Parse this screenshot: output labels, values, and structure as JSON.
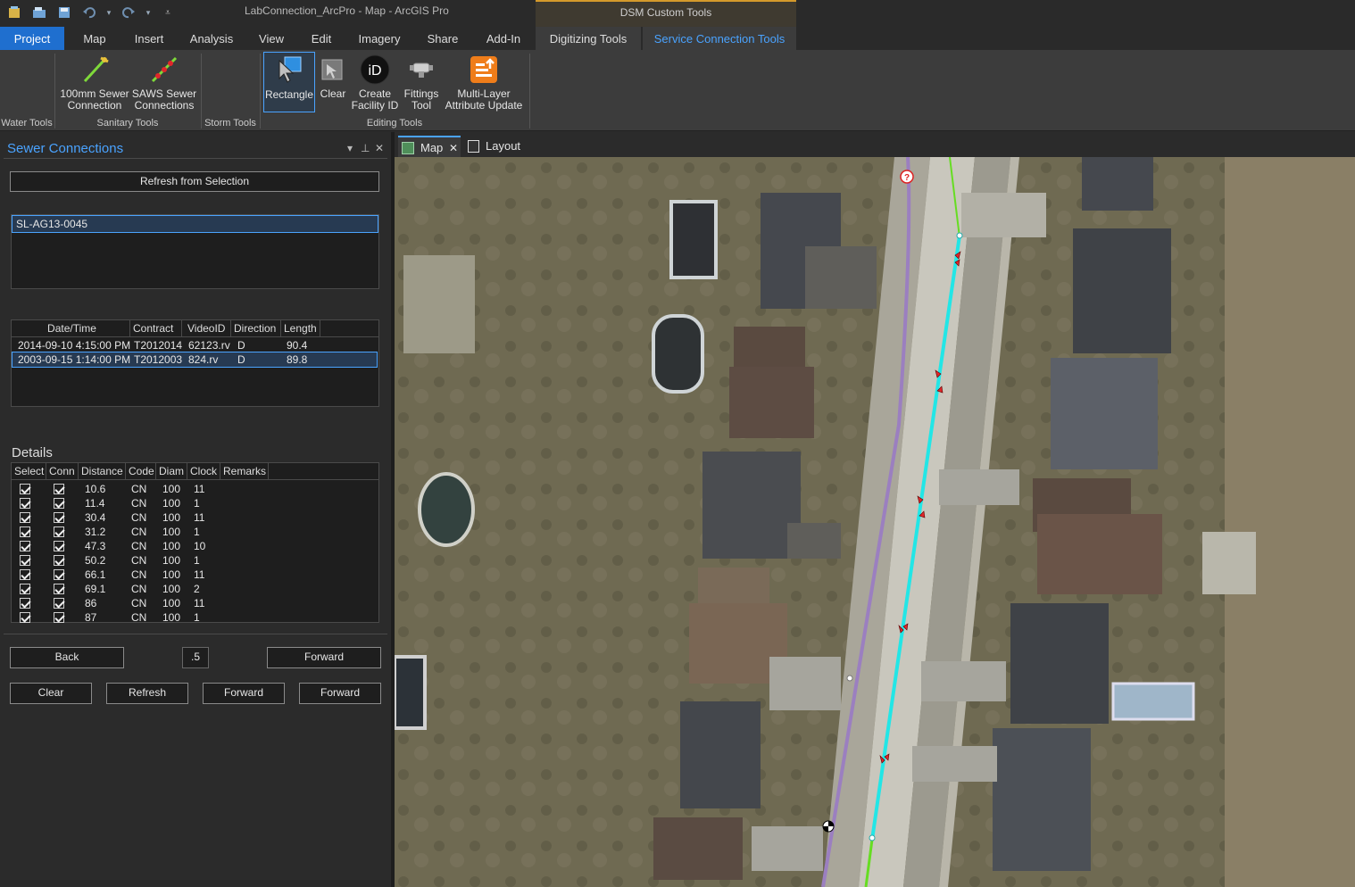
{
  "app": {
    "title": "LabConnection_ArcPro - Map - ArcGIS Pro",
    "context_header": "DSM Custom Tools"
  },
  "tabs": [
    {
      "label": "Project"
    },
    {
      "label": "Map"
    },
    {
      "label": "Insert"
    },
    {
      "label": "Analysis"
    },
    {
      "label": "View"
    },
    {
      "label": "Edit"
    },
    {
      "label": "Imagery"
    },
    {
      "label": "Share"
    },
    {
      "label": "Add-In"
    },
    {
      "label": "Digitizing Tools"
    },
    {
      "label": "Service Connection Tools"
    }
  ],
  "ribbon": {
    "groups": {
      "water": "Water Tools",
      "sanitary": "Sanitary Tools",
      "storm": "Storm Tools",
      "editing": "Editing Tools"
    },
    "buttons": {
      "sewer100_l1": "100mm Sewer",
      "sewer100_l2": "Connection",
      "saws_l1": "SAWS Sewer",
      "saws_l2": "Connections",
      "rectangle": "Rectangle",
      "clear": "Clear",
      "create_l1": "Create",
      "create_l2": "Facility ID",
      "fittings_l1": "Fittings",
      "fittings_l2": "Tool",
      "multilayer_l1": "Multi-Layer",
      "multilayer_l2": "Attribute Update"
    }
  },
  "pane": {
    "title": "Sewer Connections",
    "refresh_button": "Refresh from Selection",
    "selected_id": "SL-AG13-0045",
    "inspection_headers": [
      "Date/Time",
      "Contract",
      "VideoID",
      "Direction",
      "Length"
    ],
    "inspections": [
      {
        "datetime": "2014-09-10 4:15:00 PM",
        "contract": "T2012014",
        "video": "62123.rv",
        "direction": "D",
        "length": "90.4"
      },
      {
        "datetime": "2003-09-15 1:14:00 PM",
        "contract": "T2012003",
        "video": "824.rv",
        "direction": "D",
        "length": "89.8"
      }
    ],
    "details_label": "Details",
    "detail_headers": [
      "Select",
      "Conn",
      "Distance",
      "Code",
      "Diam",
      "Clock",
      "Remarks"
    ],
    "details": [
      {
        "distance": "10.6",
        "code": "CN",
        "diam": "100",
        "clock": "11"
      },
      {
        "distance": "11.4",
        "code": "CN",
        "diam": "100",
        "clock": "1"
      },
      {
        "distance": "30.4",
        "code": "CN",
        "diam": "100",
        "clock": "11"
      },
      {
        "distance": "31.2",
        "code": "CN",
        "diam": "100",
        "clock": "1"
      },
      {
        "distance": "47.3",
        "code": "CN",
        "diam": "100",
        "clock": "10"
      },
      {
        "distance": "50.2",
        "code": "CN",
        "diam": "100",
        "clock": "1"
      },
      {
        "distance": "66.1",
        "code": "CN",
        "diam": "100",
        "clock": "11"
      },
      {
        "distance": "69.1",
        "code": "CN",
        "diam": "100",
        "clock": "2"
      },
      {
        "distance": "86",
        "code": "CN",
        "diam": "100",
        "clock": "11"
      },
      {
        "distance": "87",
        "code": "CN",
        "diam": "100",
        "clock": "1"
      }
    ],
    "back_button": "Back",
    "step_value": ".5",
    "forward_button": "Forward",
    "clear_button": "Clear",
    "refresh2_button": "Refresh",
    "forward2_button": "Forward",
    "forward3_button": "Forward"
  },
  "view_tabs": {
    "map": "Map",
    "layout": "Layout"
  },
  "colors": {
    "accent": "#4aa3ff",
    "project_tab": "#1f6fcf",
    "sewer_main": "#9b7fc0",
    "service_line": "#22e6e6",
    "green_line": "#66dd22",
    "marker": "#e0262a"
  }
}
